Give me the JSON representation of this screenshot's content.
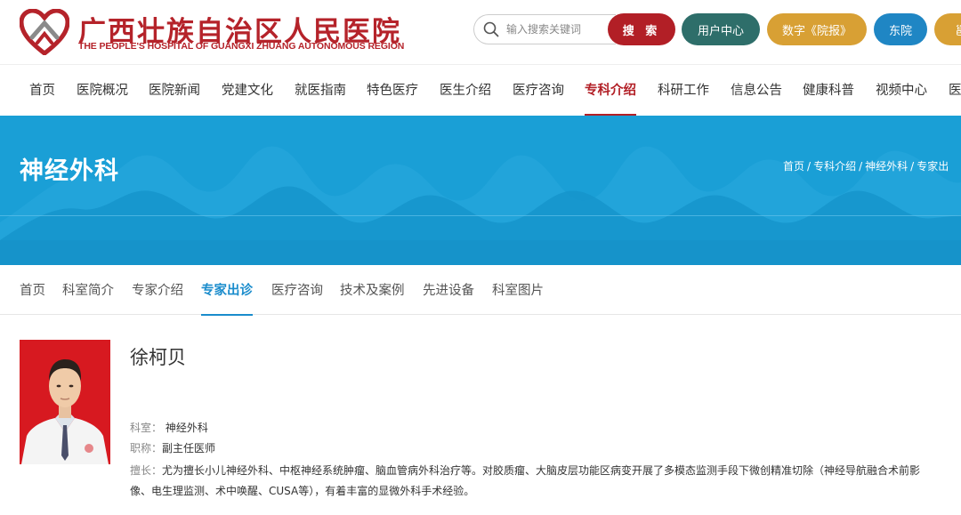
{
  "header": {
    "logo_cn": "广西壮族自治区人民医院",
    "logo_en": "THE PEOPLE'S HOSPITAL OF GUANGXI ZHUANG AUTONOMOUS REGION",
    "search_placeholder": "输入搜索关键词",
    "search_button": "搜 索",
    "user_center": "用户中心",
    "digital_paper": "数字《院报》",
    "east_campus": "东院",
    "last_pill": "邕",
    "colors": {
      "brand_red": "#b21f26",
      "teal": "#2e6e6a",
      "gold": "#d8a034",
      "blue": "#1f86c4"
    }
  },
  "nav": {
    "items": [
      "首页",
      "医院概况",
      "医院新闻",
      "党建文化",
      "就医指南",
      "特色医疗",
      "医生介绍",
      "医疗咨询",
      "专科介绍",
      "科研工作",
      "信息公告",
      "健康科普",
      "视频中心",
      "医"
    ],
    "active": "专科介绍"
  },
  "banner": {
    "title": "神经外科",
    "breadcrumb": [
      "首页",
      "专科介绍",
      "神经外科",
      "专家出"
    ],
    "color": "#1a9fd6"
  },
  "subnav": {
    "items": [
      "首页",
      "科室简介",
      "专家介绍",
      "专家出诊",
      "医疗咨询",
      "技术及案例",
      "先进设备",
      "科室图片"
    ],
    "active": "专家出诊"
  },
  "doctor": {
    "name": "徐柯贝",
    "dept_label": "科室：",
    "dept_value": "神经外科",
    "title_label": "职称：",
    "title_value": "副主任医师",
    "spec_label": "擅长：",
    "spec_value": "尤为擅长小儿神经外科、中枢神经系统肿瘤、脑血管病外科治疗等。对胶质瘤、大脑皮层功能区病变开展了多模态监测手段下微创精准切除（神经导航融合术前影像、电生理监测、术中唤醒、CUSA等），有着丰富的显微外科手术经验。",
    "photo_icon": "doctor-portrait"
  }
}
